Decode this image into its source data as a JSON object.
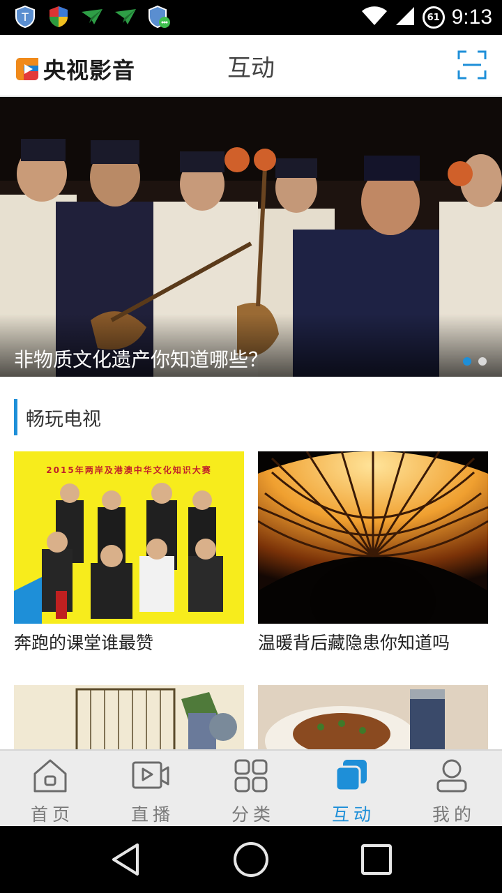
{
  "status_bar": {
    "time": "9:13",
    "battery_level": "61",
    "left_icons": [
      "shield-icon",
      "shield-color-icon",
      "paper-plane-icon",
      "paper-plane-icon",
      "shield-chat-icon"
    ],
    "right_icons": [
      "wifi-icon",
      "signal-icon",
      "battery-icon"
    ]
  },
  "app_bar": {
    "logo_text": "央视影音",
    "title": "互动",
    "scan_icon": "scan-icon",
    "accent_color": "#1e8fd8"
  },
  "banner": {
    "caption": "非物质文化遗产你知道哪些？",
    "dots": 2,
    "active_dot": 1
  },
  "section": {
    "title": "畅玩电视",
    "cards": [
      {
        "title": "奔跑的课堂谁最赞",
        "poster_text": "2015年两岸及港澳中华文化知识大赛"
      },
      {
        "title": "温暖背后藏隐患你知道吗"
      },
      {
        "title": ""
      },
      {
        "title": ""
      }
    ]
  },
  "tabs": [
    {
      "label": "首页",
      "icon": "home-icon",
      "active": false
    },
    {
      "label": "直播",
      "icon": "live-video-icon",
      "active": false
    },
    {
      "label": "分类",
      "icon": "grid-icon",
      "active": false
    },
    {
      "label": "互动",
      "icon": "interact-icon",
      "active": true
    },
    {
      "label": "我的",
      "icon": "user-icon",
      "active": false
    }
  ],
  "nav_bar": {
    "icons": [
      "back-icon",
      "home-circle-icon",
      "recents-icon"
    ]
  }
}
